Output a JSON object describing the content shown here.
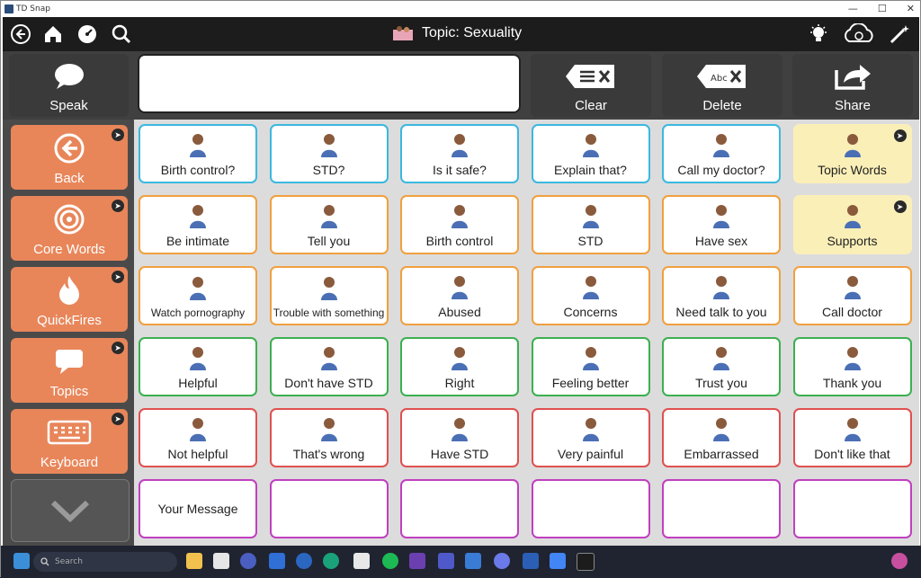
{
  "window": {
    "title": "TD Snap"
  },
  "toolbar": {
    "title": "Topic: Sexuality"
  },
  "speak_bar": {
    "speak_label": "Speak",
    "message_value": "",
    "clear_label": "Clear",
    "delete_label": "Delete",
    "share_label": "Share"
  },
  "sidebar": {
    "items": [
      {
        "label": "Back",
        "icon": "back-arrow-icon"
      },
      {
        "label": "Core Words",
        "icon": "target-icon"
      },
      {
        "label": "QuickFires",
        "icon": "flame-icon"
      },
      {
        "label": "Topics",
        "icon": "speech-bubble-icon"
      },
      {
        "label": "Keyboard",
        "icon": "keyboard-icon"
      }
    ],
    "more_icon": "chevron-down-icon"
  },
  "grid": {
    "rows": [
      [
        {
          "label": "Birth control?",
          "color": "blue"
        },
        {
          "label": "STD?",
          "color": "blue"
        },
        {
          "label": "Is it safe?",
          "color": "blue"
        },
        {
          "label": "Explain that?",
          "color": "blue"
        },
        {
          "label": "Call my doctor?",
          "color": "blue"
        },
        {
          "label": "Topic Words",
          "color": "yellow"
        }
      ],
      [
        {
          "label": "Be intimate",
          "color": "orange"
        },
        {
          "label": "Tell you",
          "color": "orange"
        },
        {
          "label": "Birth control",
          "color": "orange"
        },
        {
          "label": "STD",
          "color": "orange"
        },
        {
          "label": "Have sex",
          "color": "orange"
        },
        {
          "label": "Supports",
          "color": "yellow"
        }
      ],
      [
        {
          "label": "Watch pornography",
          "color": "orange"
        },
        {
          "label": "Trouble with something",
          "color": "orange"
        },
        {
          "label": "Abused",
          "color": "orange"
        },
        {
          "label": "Concerns",
          "color": "orange"
        },
        {
          "label": "Need talk to you",
          "color": "orange"
        },
        {
          "label": "Call doctor",
          "color": "orange"
        }
      ],
      [
        {
          "label": "Helpful",
          "color": "green"
        },
        {
          "label": "Don't have STD",
          "color": "green"
        },
        {
          "label": "Right",
          "color": "green"
        },
        {
          "label": "Feeling better",
          "color": "green"
        },
        {
          "label": "Trust you",
          "color": "green"
        },
        {
          "label": "Thank you",
          "color": "green"
        }
      ],
      [
        {
          "label": "Not helpful",
          "color": "red"
        },
        {
          "label": "That's wrong",
          "color": "red"
        },
        {
          "label": "Have STD",
          "color": "red"
        },
        {
          "label": "Very painful",
          "color": "red"
        },
        {
          "label": "Embarrassed",
          "color": "red"
        },
        {
          "label": "Don't like that",
          "color": "red"
        }
      ],
      [
        {
          "label": "Your Message",
          "color": "purple"
        },
        {
          "label": "",
          "color": "purple"
        },
        {
          "label": "",
          "color": "purple"
        },
        {
          "label": "",
          "color": "purple"
        },
        {
          "label": "",
          "color": "purple"
        },
        {
          "label": "",
          "color": "purple"
        }
      ]
    ]
  },
  "colors": {
    "blue": "#3bb8e0",
    "orange": "#f0a040",
    "green": "#3cb050",
    "red": "#e05050",
    "purple": "#c040c0",
    "yellow": "#fbefb8",
    "sidebar": "#e8865a"
  },
  "taskbar": {
    "search_placeholder": "Search"
  }
}
